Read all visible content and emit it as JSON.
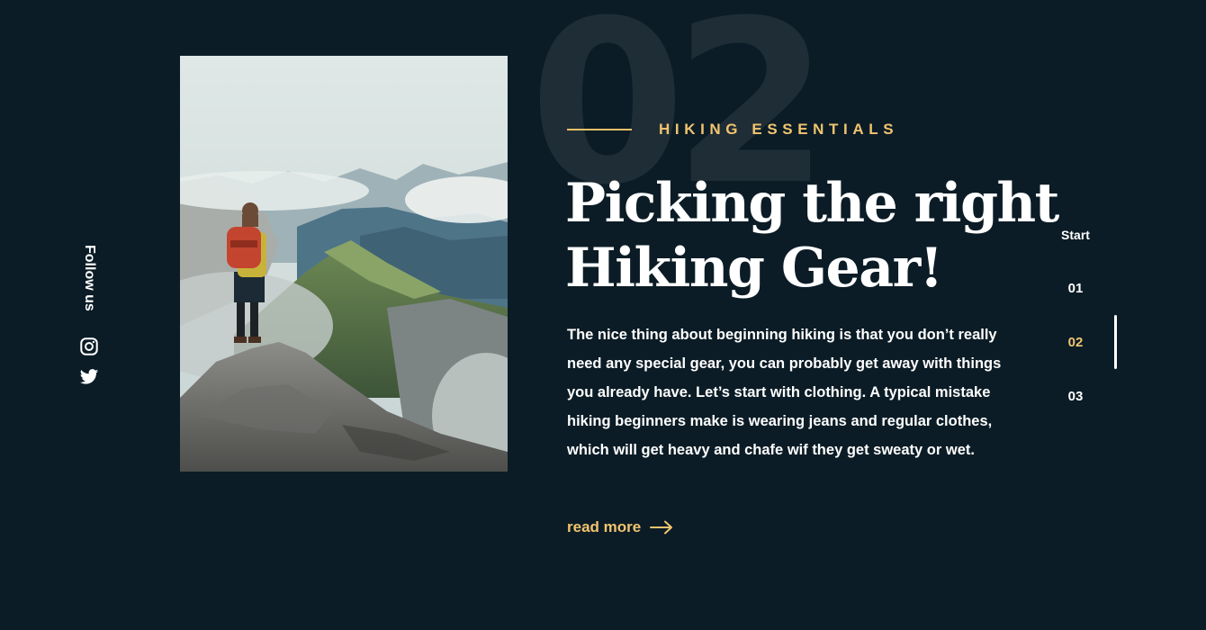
{
  "social": {
    "follow_label": "Follow us",
    "icons": [
      "instagram-icon",
      "twitter-icon"
    ]
  },
  "hero": {
    "number": "02",
    "eyebrow": "HIKING ESSENTIALS",
    "heading_line1": "Picking the right",
    "heading_line2": "Hiking Gear!",
    "body": "The nice thing about beginning hiking is that you don’t really need any special gear, you can probably get away with things you already have. Let’s start with clothing. A typical mistake hiking beginners make is wearing jeans and regular clothes, which will get heavy and chafe wif they get sweaty or wet.",
    "read_more": "read more"
  },
  "pager": {
    "start": "Start",
    "items": [
      "01",
      "02",
      "03"
    ],
    "active_index": 1
  },
  "colors": {
    "background": "#0b1c26",
    "accent": "#f1c46f",
    "big_number": "#1f2d36"
  }
}
